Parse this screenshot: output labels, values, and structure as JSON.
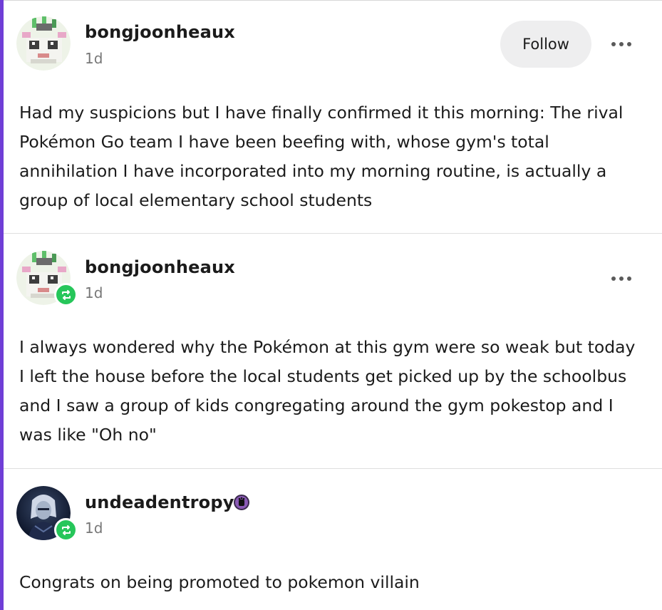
{
  "posts": [
    {
      "username": "bongjoonheaux",
      "time": "1d",
      "follow_label": "Follow",
      "more_icon": "more-dots-icon",
      "text": "Had my suspicions but I have finally confirmed it this morning: The rival Pokémon Go team I have been beefing with, whose gym's total annihilation I have incorporated into my morning routine, is actually a group of local elementary school students"
    },
    {
      "username": "bongjoonheaux",
      "time": "1d",
      "reblog_icon": "reblog-icon",
      "more_icon": "more-dots-icon",
      "text": "I always wondered why the Pokémon at this gym were so weak but today I left the house before the local students get picked up by the schoolbus and I saw a group of kids congregating around the gym pokestop and I was like \"Oh no\""
    },
    {
      "username": "undeadentropy",
      "time": "1d",
      "reblog_icon": "reblog-icon",
      "badge_icon": "user-badge-icon",
      "text": "Congrats on being promoted to pokemon villain"
    }
  ],
  "colors": {
    "accent": "#6f3ed6",
    "reblog_green": "#26c65a",
    "muted_text": "#777777",
    "follow_bg": "#eeeeef"
  }
}
